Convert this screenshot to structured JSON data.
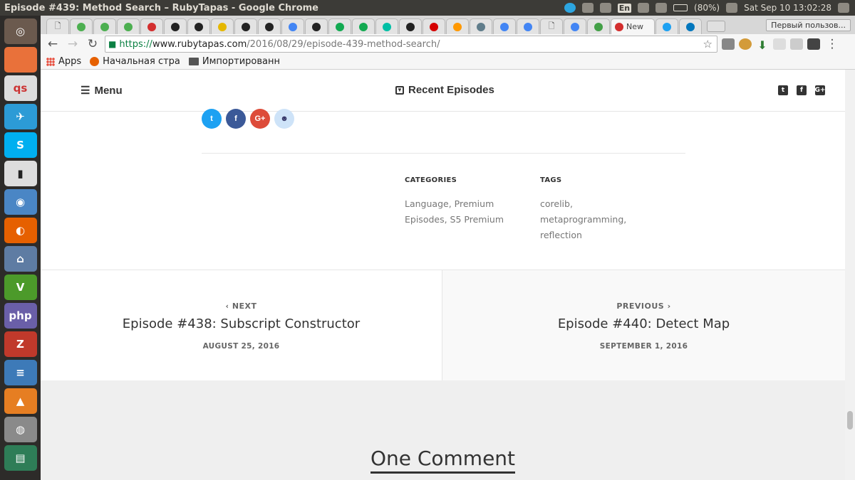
{
  "os": {
    "window_title": "Episode #439: Method Search – RubyTapas - Google Chrome",
    "tray": {
      "lang": "En",
      "battery": "(80%)",
      "datetime": "Sat Sep 10 13:02:28"
    }
  },
  "browser": {
    "active_tab_label": "New",
    "profile": "Первый пользов...",
    "url": {
      "scheme": "https://",
      "host": "www.rubytapas.com",
      "path": "/2016/08/29/episode-439-method-search/"
    },
    "bookmarks": [
      {
        "label": "Apps",
        "icon": "apps-grid-icon"
      },
      {
        "label": "Начальная стра",
        "icon": "firefox-icon"
      },
      {
        "label": "Импортированн",
        "icon": "folder-icon"
      }
    ]
  },
  "site": {
    "menu_label": "Menu",
    "recent_label": "Recent Episodes",
    "share_buttons": [
      {
        "name": "twitter",
        "glyph": "t",
        "color": "#1da1f2"
      },
      {
        "name": "facebook",
        "glyph": "f",
        "color": "#3b5998"
      },
      {
        "name": "google-plus",
        "glyph": "G+",
        "color": "#dd4b39"
      },
      {
        "name": "reddit",
        "glyph": "☻",
        "color": "#cee3f8"
      }
    ],
    "categories": {
      "heading": "CATEGORIES",
      "line1": "Language, Premium",
      "line2": "Episodes, S5 Premium"
    },
    "tags": {
      "heading": "TAGS",
      "line1": "corelib,",
      "line2": "metaprogramming,",
      "line3": "reflection"
    },
    "post_nav": {
      "next": {
        "label": "‹  NEXT",
        "title": "Episode #438: Subscript Constructor",
        "date": "AUGUST 25, 2016"
      },
      "previous": {
        "label": "PREVIOUS  ›",
        "title": "Episode #440: Detect Map",
        "date": "SEPTEMBER 1, 2016"
      }
    },
    "comments_heading": "One Comment"
  }
}
